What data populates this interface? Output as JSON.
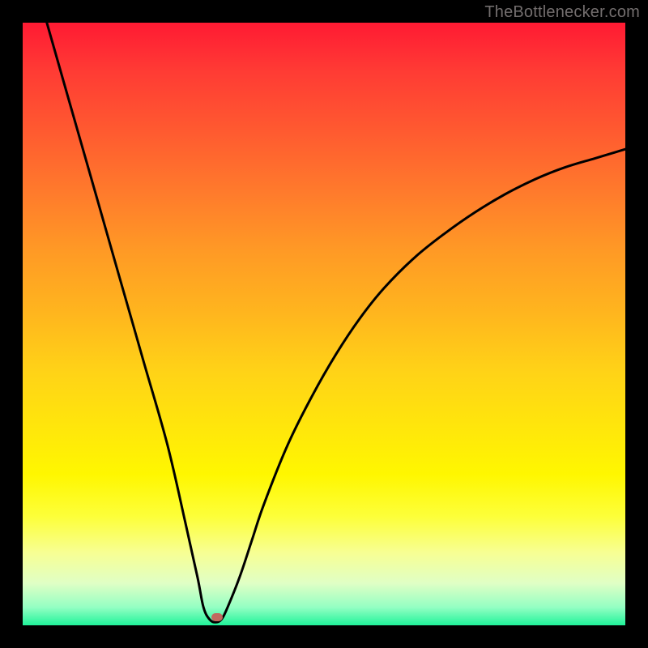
{
  "watermark": {
    "text": "TheBottlenecker.com"
  },
  "chart_data": {
    "type": "line",
    "title": "",
    "xlabel": "",
    "ylabel": "",
    "xlim": [
      0,
      100
    ],
    "ylim": [
      0,
      100
    ],
    "series": [
      {
        "name": "bottleneck-curve",
        "color": "#000000",
        "x": [
          4,
          8,
          12,
          16,
          20,
          24,
          27,
          29,
          30,
          31,
          32,
          33,
          34,
          36,
          38,
          40,
          44,
          48,
          52,
          56,
          60,
          65,
          70,
          75,
          80,
          85,
          90,
          95,
          100
        ],
        "values": [
          100,
          86,
          72,
          58,
          44,
          30,
          17,
          8,
          3,
          1,
          0.5,
          1,
          3,
          8,
          14,
          20,
          30,
          38,
          45,
          51,
          56,
          61,
          65,
          68.5,
          71.5,
          74,
          76,
          77.5,
          79
        ]
      }
    ],
    "marker": {
      "x": 32.3,
      "y": 1.3,
      "color": "#c26a5f"
    },
    "gradient_stops": [
      {
        "pos": 0,
        "color": "#ff1a33"
      },
      {
        "pos": 50,
        "color": "#ffd317"
      },
      {
        "pos": 80,
        "color": "#fff700"
      },
      {
        "pos": 100,
        "color": "#20f39a"
      }
    ]
  }
}
